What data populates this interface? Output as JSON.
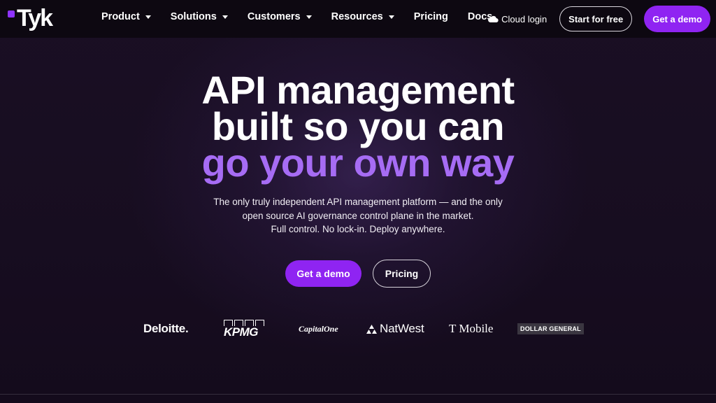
{
  "nav": {
    "logo_text": "Tyk",
    "menu": [
      {
        "label": "Product",
        "has_dropdown": true
      },
      {
        "label": "Solutions",
        "has_dropdown": true
      },
      {
        "label": "Customers",
        "has_dropdown": true
      },
      {
        "label": "Resources",
        "has_dropdown": true
      },
      {
        "label": "Pricing",
        "has_dropdown": false
      },
      {
        "label": "Docs",
        "has_dropdown": false
      }
    ],
    "cloud_login": "Cloud login",
    "start_free": "Start for free",
    "get_demo": "Get a demo"
  },
  "hero": {
    "title_line1": "API management",
    "title_line2": "built so you can",
    "title_accent": "go your own way",
    "sub_line1": "The only truly independent API management platform — and the only",
    "sub_line2": "open source AI governance control plane in the market.",
    "sub_line3": "Full control. No lock-in. Deploy anywhere.",
    "cta_primary": "Get a demo",
    "cta_secondary": "Pricing"
  },
  "logos": {
    "deloitte": "Deloitte.",
    "kpmg": "KPMG",
    "capital_one": "CapitalOne",
    "natwest": "NatWest",
    "tmobile": "T Mobile",
    "dollar_general": "DOLLAR GENERAL"
  },
  "colors": {
    "accent": "#8f24f2",
    "title_accent": "#a66cf4",
    "nav_bg": "#0d0811",
    "page_bg": "#170d20"
  },
  "icons": {
    "cloud": "cloud-icon",
    "caret": "chevron-down-icon",
    "natwest": "natwest-logo-icon"
  }
}
